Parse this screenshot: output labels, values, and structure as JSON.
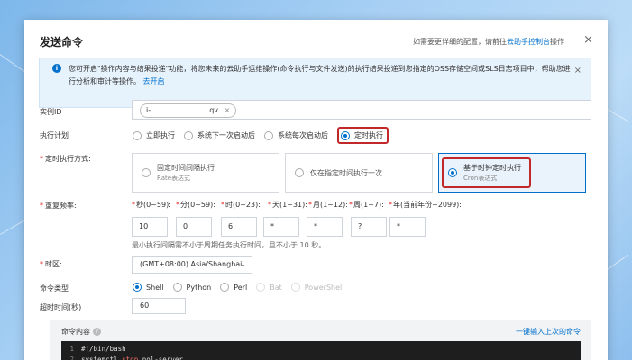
{
  "dialog": {
    "title": "发送命令",
    "help_prefix": "如需要更详细的配置，请前往",
    "help_link": "云助手控制台",
    "help_suffix": "操作",
    "close": "×"
  },
  "notice": {
    "text": "您可开启\"操作内容与结果投递\"功能，将您未来的云助手运维操作(命令执行与文件发送)的执行结果投递到您指定的OSS存储空间或SLS日志项目中，帮助您进行分析和审计等操作。",
    "link": "去开启",
    "close": "×"
  },
  "instance": {
    "label": "实例ID",
    "tag_prefix": "i-",
    "tag_suffix": "qv",
    "tag_close": "×"
  },
  "plan": {
    "label": "执行计划",
    "options": [
      "立即执行",
      "系统下一次启动后",
      "系统每次启动后",
      "定时执行"
    ],
    "selected": 3
  },
  "timing": {
    "label": "定时执行方式:",
    "cards": [
      {
        "title": "固定时间间隔执行",
        "sub": "Rate表达式"
      },
      {
        "title": "仅在指定时间执行一次",
        "sub": ""
      },
      {
        "title": "基于时钟定时执行",
        "sub": "Cron表达式"
      }
    ],
    "selected": 2
  },
  "frequency": {
    "label": "重复频率:",
    "fields": [
      {
        "head": "秒(0~59):",
        "value": "10"
      },
      {
        "head": "分(0~59):",
        "value": "0"
      },
      {
        "head": "时(0~23):",
        "value": "6"
      },
      {
        "head": "天(1~31):",
        "value": "*"
      },
      {
        "head": "月(1~12):",
        "value": "*"
      },
      {
        "head": "周(1~7):",
        "value": "?"
      },
      {
        "head": "年(当前年份~2099):",
        "value": "*"
      }
    ],
    "hint": "最小执行间隔需不小于周期任务执行时间，且不小于 10 秒。"
  },
  "timezone": {
    "label": "时区:",
    "value": "(GMT+08:00) Asia/Shanghai"
  },
  "cmdtype": {
    "label": "命令类型",
    "options": [
      "Shell",
      "Python",
      "Perl",
      "Bat",
      "PowerShell"
    ],
    "selected": 0,
    "disabled": [
      3,
      4
    ]
  },
  "timeout": {
    "label": "超时时间(秒)",
    "value": "60"
  },
  "code": {
    "label": "命令内容",
    "link": "一键输入上次的命令",
    "line1_no": "1",
    "line1": "#!/bin/bash",
    "line2_no": "2",
    "line2_a": "systemctl ",
    "line2_b": "stop",
    "line2_c": " nol-server"
  },
  "colors": {
    "accent": "#0070cc",
    "highlight": "#c0282a",
    "required": "#e02020"
  }
}
